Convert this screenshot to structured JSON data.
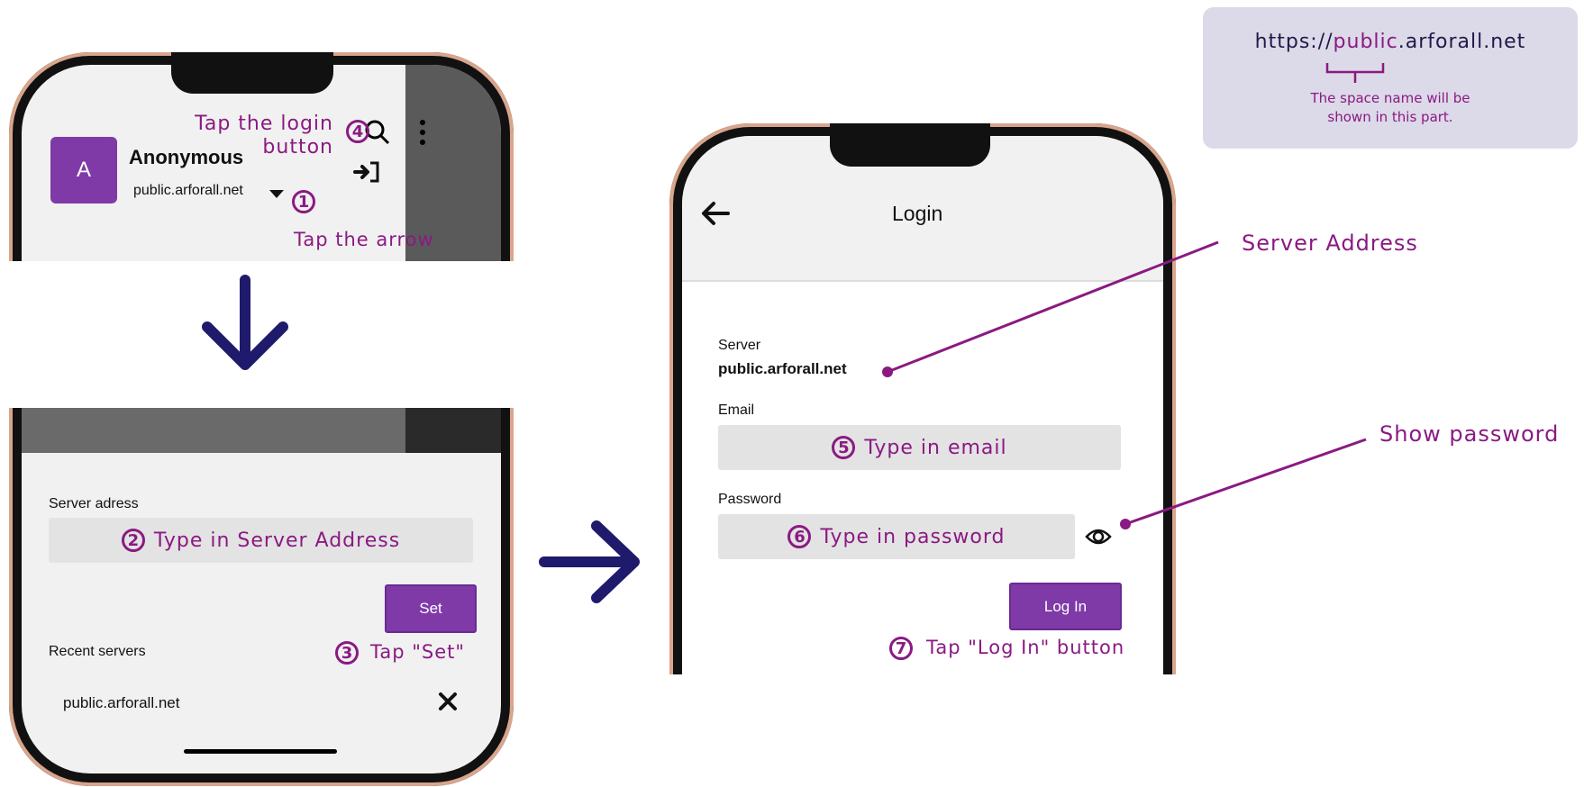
{
  "url_card": {
    "prefix": "https://",
    "space": "public",
    "suffix": ".arforall.net",
    "note_line1": "The space name will be",
    "note_line2": "shown in this part."
  },
  "phone1": {
    "avatar_letter": "A",
    "user_name": "Anonymous",
    "server": "public.arforall.net"
  },
  "phone2": {
    "server_label": "Server adress",
    "set_button": "Set",
    "recent_label": "Recent servers",
    "recent_item": "public.arforall.net"
  },
  "phone3": {
    "title": "Login",
    "server_label": "Server",
    "server_value": "public.arforall.net",
    "email_label": "Email",
    "password_label": "Password",
    "login_button": "Log In"
  },
  "annotations": {
    "step1_num": "1",
    "step1": "Tap the arrow",
    "step2_num": "2",
    "step2": "Type in Server Address",
    "step3_num": "3",
    "step3": "Tap \"Set\"",
    "step4_num": "4",
    "step4_line1": "Tap the login",
    "step4_line2": "button",
    "step5_num": "5",
    "step5": "Type in email",
    "step6_num": "6",
    "step6": "Type in password",
    "step7_num": "7",
    "step7": "Tap \"Log In\" button",
    "server_address": "Server Address",
    "show_password": "Show password"
  },
  "colors": {
    "accent": "#8a1a82",
    "button": "#7f3aa7",
    "arrow": "#1f1a6b"
  }
}
